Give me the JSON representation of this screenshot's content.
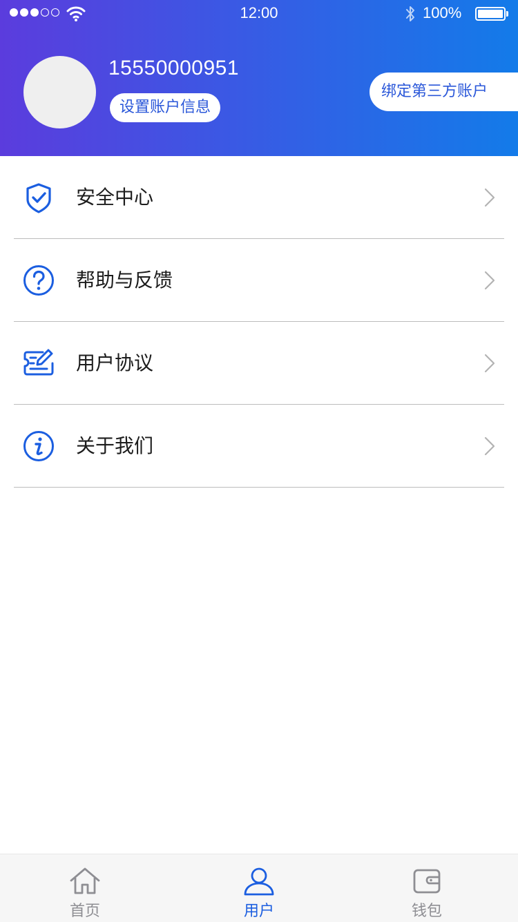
{
  "status_bar": {
    "time": "12:00",
    "battery": "100%",
    "signal_dots_filled": 3,
    "signal_dots_total": 5
  },
  "profile": {
    "phone": "15550000951",
    "settings_label": "设置账户信息",
    "bind_label": "绑定第三方账户"
  },
  "menu": {
    "items": [
      {
        "label": "安全中心",
        "icon": "shield-check-icon"
      },
      {
        "label": "帮助与反馈",
        "icon": "help-circle-icon"
      },
      {
        "label": "用户协议",
        "icon": "agreement-edit-icon"
      },
      {
        "label": "关于我们",
        "icon": "info-circle-icon"
      }
    ]
  },
  "tabbar": {
    "tabs": [
      {
        "label": "首页",
        "icon": "home-icon",
        "active": false
      },
      {
        "label": "用户",
        "icon": "user-icon",
        "active": true
      },
      {
        "label": "钱包",
        "icon": "wallet-icon",
        "active": false
      }
    ]
  },
  "colors": {
    "gradient_start": "#5b3cdd",
    "gradient_end": "#137be9",
    "accent": "#1b5ee0",
    "tab_inactive": "#8e8e93",
    "divider": "#bcbcbc"
  }
}
